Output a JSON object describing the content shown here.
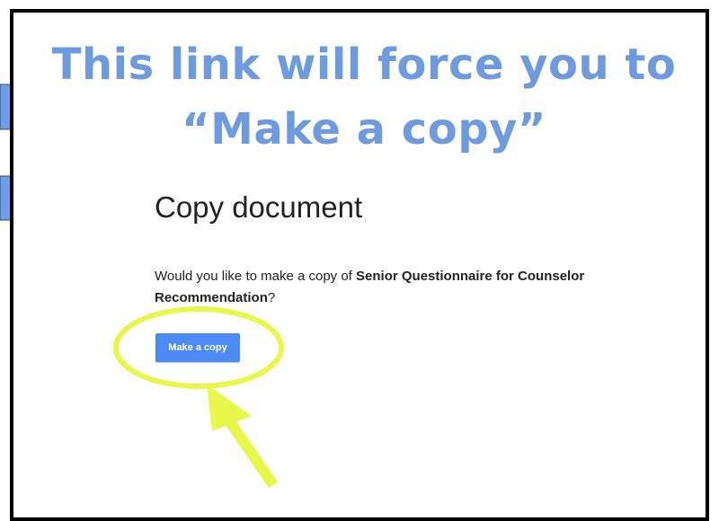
{
  "headline": {
    "line1": "This link will force you to",
    "line2": "“Make a copy”"
  },
  "dialog": {
    "title": "Copy document",
    "prompt_before": "Would you like to make a copy of ",
    "document_name": "Senior Questionnaire for Counselor Recommendation",
    "prompt_after": "?",
    "button_label": "Make a copy"
  },
  "colors": {
    "headline": "#6e9bdf",
    "button": "#4c8bf5",
    "highlight": "#e9f74a",
    "side_arrows": "#6d9eeb"
  },
  "icons": [
    "side-arrow-icon",
    "highlight-circle",
    "pointer-arrow-icon"
  ]
}
